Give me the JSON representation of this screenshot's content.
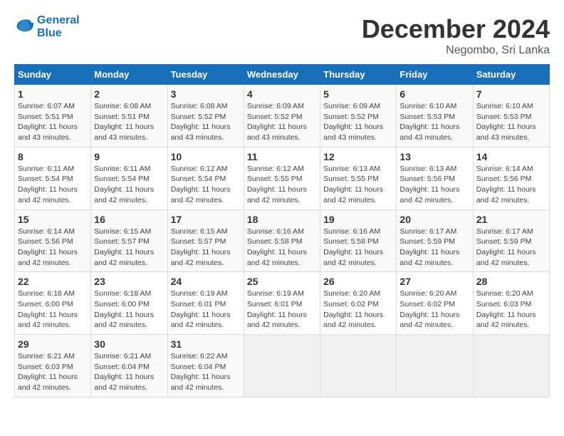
{
  "header": {
    "logo_line1": "General",
    "logo_line2": "Blue",
    "month": "December 2024",
    "location": "Negombo, Sri Lanka"
  },
  "weekdays": [
    "Sunday",
    "Monday",
    "Tuesday",
    "Wednesday",
    "Thursday",
    "Friday",
    "Saturday"
  ],
  "weeks": [
    [
      {
        "day": "1",
        "sunrise": "6:07 AM",
        "sunset": "5:51 PM",
        "daylight": "11 hours and 43 minutes."
      },
      {
        "day": "2",
        "sunrise": "6:08 AM",
        "sunset": "5:51 PM",
        "daylight": "11 hours and 43 minutes."
      },
      {
        "day": "3",
        "sunrise": "6:08 AM",
        "sunset": "5:52 PM",
        "daylight": "11 hours and 43 minutes."
      },
      {
        "day": "4",
        "sunrise": "6:09 AM",
        "sunset": "5:52 PM",
        "daylight": "11 hours and 43 minutes."
      },
      {
        "day": "5",
        "sunrise": "6:09 AM",
        "sunset": "5:52 PM",
        "daylight": "11 hours and 43 minutes."
      },
      {
        "day": "6",
        "sunrise": "6:10 AM",
        "sunset": "5:53 PM",
        "daylight": "11 hours and 43 minutes."
      },
      {
        "day": "7",
        "sunrise": "6:10 AM",
        "sunset": "5:53 PM",
        "daylight": "11 hours and 43 minutes."
      }
    ],
    [
      {
        "day": "8",
        "sunrise": "6:11 AM",
        "sunset": "5:54 PM",
        "daylight": "11 hours and 42 minutes."
      },
      {
        "day": "9",
        "sunrise": "6:11 AM",
        "sunset": "5:54 PM",
        "daylight": "11 hours and 42 minutes."
      },
      {
        "day": "10",
        "sunrise": "6:12 AM",
        "sunset": "5:54 PM",
        "daylight": "11 hours and 42 minutes."
      },
      {
        "day": "11",
        "sunrise": "6:12 AM",
        "sunset": "5:55 PM",
        "daylight": "11 hours and 42 minutes."
      },
      {
        "day": "12",
        "sunrise": "6:13 AM",
        "sunset": "5:55 PM",
        "daylight": "11 hours and 42 minutes."
      },
      {
        "day": "13",
        "sunrise": "6:13 AM",
        "sunset": "5:56 PM",
        "daylight": "11 hours and 42 minutes."
      },
      {
        "day": "14",
        "sunrise": "6:14 AM",
        "sunset": "5:56 PM",
        "daylight": "11 hours and 42 minutes."
      }
    ],
    [
      {
        "day": "15",
        "sunrise": "6:14 AM",
        "sunset": "5:56 PM",
        "daylight": "11 hours and 42 minutes."
      },
      {
        "day": "16",
        "sunrise": "6:15 AM",
        "sunset": "5:57 PM",
        "daylight": "11 hours and 42 minutes."
      },
      {
        "day": "17",
        "sunrise": "6:15 AM",
        "sunset": "5:57 PM",
        "daylight": "11 hours and 42 minutes."
      },
      {
        "day": "18",
        "sunrise": "6:16 AM",
        "sunset": "5:58 PM",
        "daylight": "11 hours and 42 minutes."
      },
      {
        "day": "19",
        "sunrise": "6:16 AM",
        "sunset": "5:58 PM",
        "daylight": "11 hours and 42 minutes."
      },
      {
        "day": "20",
        "sunrise": "6:17 AM",
        "sunset": "5:59 PM",
        "daylight": "11 hours and 42 minutes."
      },
      {
        "day": "21",
        "sunrise": "6:17 AM",
        "sunset": "5:59 PM",
        "daylight": "11 hours and 42 minutes."
      }
    ],
    [
      {
        "day": "22",
        "sunrise": "6:18 AM",
        "sunset": "6:00 PM",
        "daylight": "11 hours and 42 minutes."
      },
      {
        "day": "23",
        "sunrise": "6:18 AM",
        "sunset": "6:00 PM",
        "daylight": "11 hours and 42 minutes."
      },
      {
        "day": "24",
        "sunrise": "6:19 AM",
        "sunset": "6:01 PM",
        "daylight": "11 hours and 42 minutes."
      },
      {
        "day": "25",
        "sunrise": "6:19 AM",
        "sunset": "6:01 PM",
        "daylight": "11 hours and 42 minutes."
      },
      {
        "day": "26",
        "sunrise": "6:20 AM",
        "sunset": "6:02 PM",
        "daylight": "11 hours and 42 minutes."
      },
      {
        "day": "27",
        "sunrise": "6:20 AM",
        "sunset": "6:02 PM",
        "daylight": "11 hours and 42 minutes."
      },
      {
        "day": "28",
        "sunrise": "6:20 AM",
        "sunset": "6:03 PM",
        "daylight": "11 hours and 42 minutes."
      }
    ],
    [
      {
        "day": "29",
        "sunrise": "6:21 AM",
        "sunset": "6:03 PM",
        "daylight": "11 hours and 42 minutes."
      },
      {
        "day": "30",
        "sunrise": "6:21 AM",
        "sunset": "6:04 PM",
        "daylight": "11 hours and 42 minutes."
      },
      {
        "day": "31",
        "sunrise": "6:22 AM",
        "sunset": "6:04 PM",
        "daylight": "11 hours and 42 minutes."
      },
      null,
      null,
      null,
      null
    ]
  ]
}
